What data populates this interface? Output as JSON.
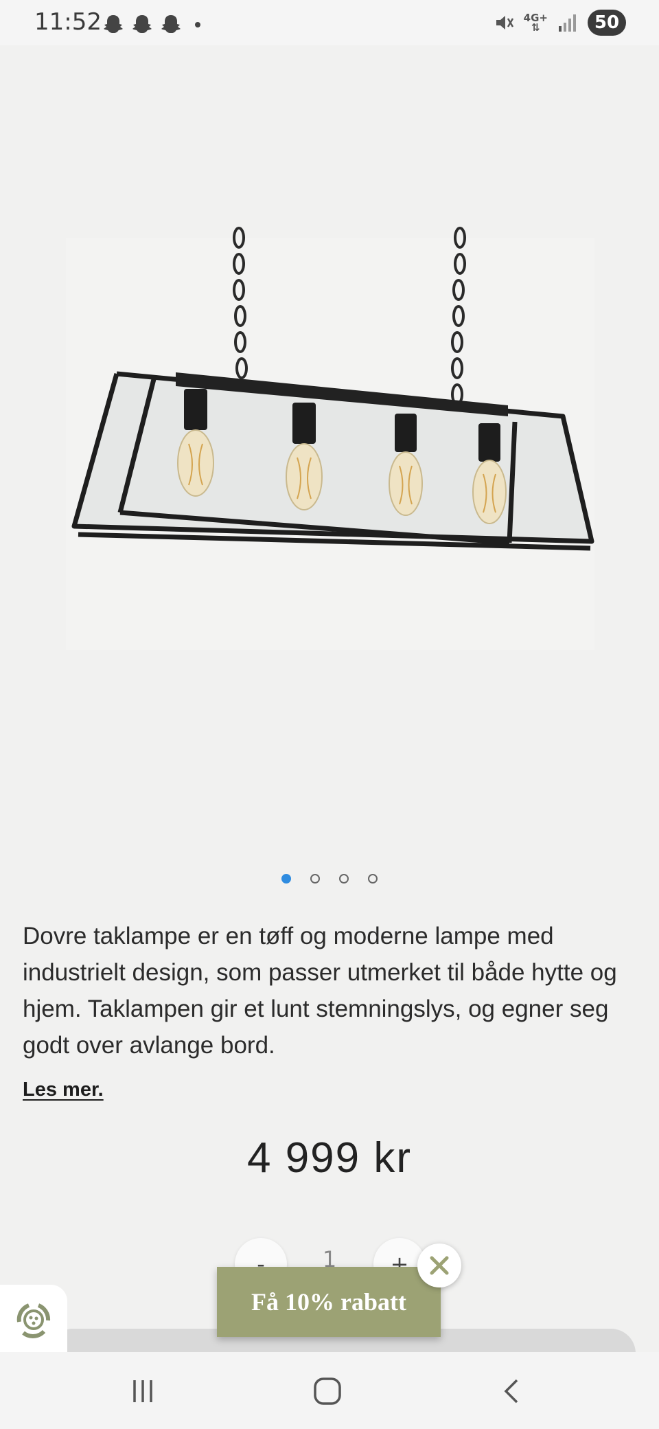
{
  "status_bar": {
    "time": "11:52",
    "notification_icons": [
      "snapchat-icon",
      "snapchat-icon",
      "snapchat-icon"
    ],
    "network_label": "4G+",
    "battery": "50"
  },
  "product": {
    "image_alt": "Dovre taklampe",
    "carousel": {
      "count": 4,
      "active_index": 0
    },
    "description": "Dovre taklampe er en tøff og moderne lampe med industrielt design, som passer utmerket til både hytte og hjem. Taklampen gir et lunt stemningslys, og egner seg godt over avlange bord.",
    "read_more": "Les mer.",
    "price": "4 999 kr",
    "quantity": {
      "minus_label": "-",
      "value": "1",
      "plus_label": "+"
    }
  },
  "popup": {
    "discount_label": "Få 10% rabatt",
    "close_icon": "close-icon"
  },
  "colors": {
    "accent": "#9ca274",
    "active_dot": "#2f8ce0",
    "background": "#f1f1f0"
  }
}
